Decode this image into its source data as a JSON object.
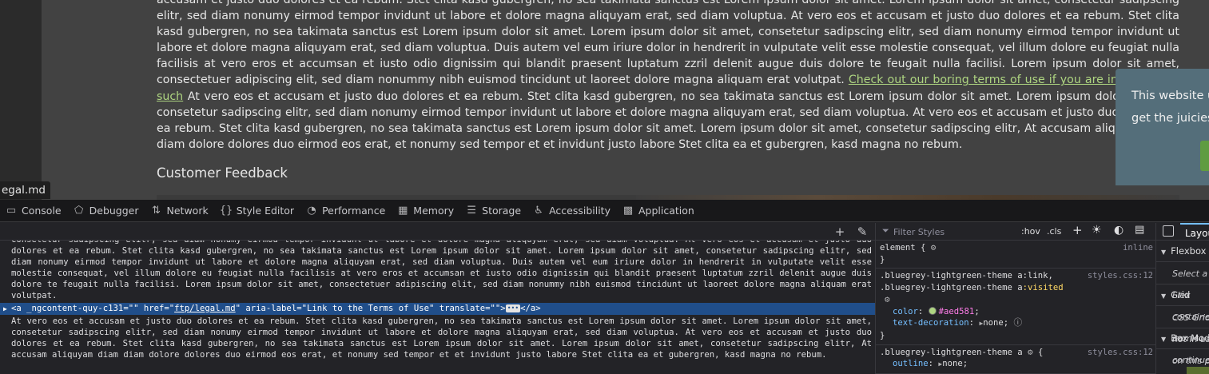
{
  "page": {
    "tab_label": "egal.md",
    "paragraph_before_link": "accusam et justo duo dolores et ea rebum. Stet clita kasd gubergren, no sea takimata sanctus est Lorem ipsum dolor sit amet. Lorem ipsum dolor sit amet, consetetur sadipscing elitr, sed diam nonumy eirmod tempor invidunt ut labore et dolore magna aliquyam erat, sed diam voluptua. At vero eos et accusam et justo duo dolores et ea rebum. Stet clita kasd gubergren, no sea takimata sanctus est Lorem ipsum dolor sit amet. Lorem ipsum dolor sit amet, consetetur sadipscing elitr, sed diam nonumy eirmod tempor invidunt ut labore et dolore magna aliquyam erat, sed diam voluptua. Duis autem vel eum iriure dolor in hendrerit in vulputate velit esse molestie consequat, vel illum dolore eu feugiat nulla facilisis at vero eros et accumsan et iusto odio dignissim qui blandit praesent luptatum zzril delenit augue duis dolore te feugait nulla facilisi. Lorem ipsum dolor sit amet, consectetuer adipiscing elit, sed diam nonummy nibh euismod tincidunt ut laoreet dolore magna aliquam erat volutpat.",
    "link_text": "Check out our boring terms of use if you are interested in such",
    "paragraph_after_link": "At vero eos et accusam et justo duo dolores et ea rebum. Stet clita kasd gubergren, no sea takimata sanctus est Lorem ipsum dolor sit amet. Lorem ipsum dolor sit amet, consetetur sadipscing elitr, sed diam nonumy eirmod tempor invidunt ut labore et dolore magna aliquyam erat, sed diam voluptua. At vero eos et accusam et justo duo dolores et ea rebum. Stet clita kasd gubergren, no sea takimata sanctus est Lorem ipsum dolor sit amet. Lorem ipsum dolor sit amet, consetetur sadipscing elitr, At accusam aliquyam diam diam dolore dolores duo eirmod eos erat, et nonumy sed tempor et et invidunt justo labore Stet clita ea et gubergren, kasd magna no rebum.",
    "feedback_heading": "Customer Feedback",
    "cookie_text": "This website uses cookies to ensure you get the juiciest tracking experience."
  },
  "devtools": {
    "tabs": [
      {
        "icon": "console-icon",
        "glyph": "▭",
        "label": "Console"
      },
      {
        "icon": "debugger-icon",
        "glyph": "⬠",
        "label": "Debugger"
      },
      {
        "icon": "network-icon",
        "glyph": "⇅",
        "label": "Network"
      },
      {
        "icon": "style-editor-icon",
        "glyph": "{}",
        "label": "Style Editor"
      },
      {
        "icon": "performance-icon",
        "glyph": "◔",
        "label": "Performance"
      },
      {
        "icon": "memory-icon",
        "glyph": "▦",
        "label": "Memory"
      },
      {
        "icon": "storage-icon",
        "glyph": "☰",
        "label": "Storage"
      },
      {
        "icon": "accessibility-icon",
        "glyph": "♿",
        "label": "Accessibility"
      },
      {
        "icon": "application-icon",
        "glyph": "▩",
        "label": "Application"
      }
    ],
    "markup": {
      "text_top": "consetetur sadipscing elitr, sed diam nonumy eirmod tempor invidunt ut labore et dolore magna aliquyam erat, sed diam voluptua. At vero eos et accusam et justo duo dolores et ea rebum. Stet clita kasd gubergren, no sea takimata sanctus est Lorem ipsum dolor sit amet. Lorem ipsum dolor sit amet, consetetur sadipscing elitr, sed diam nonumy eirmod tempor invidunt ut labore et dolore magna aliquyam erat, sed diam voluptua. Duis autem vel eum iriure dolor in hendrerit in vulputate velit esse molestie consequat, vel illum dolore eu feugiat nulla facilisis at vero eros et accumsan et iusto odio dignissim qui blandit praesent luptatum zzril delenit augue duis dolore te feugait nulla facilisi. Lorem ipsum dolor sit amet, consectetuer adipiscing elit, sed diam nonummy nibh euismod tincidunt ut laoreet dolore magna aliquam erat volutpat.",
      "selected_open": "<a _ngcontent-quy-c131=\"\" href=\"",
      "selected_href": "ftp/legal.md",
      "selected_rest": "\" aria-label=\"Link to the Terms of Use\" translate=\"\">",
      "selected_close": "</a>",
      "text_bottom": "At vero eos et accusam et justo duo dolores et ea rebum. Stet clita kasd gubergren, no sea takimata sanctus est Lorem ipsum dolor sit amet. Lorem ipsum dolor sit amet, consetetur sadipscing elitr, sed diam nonumy eirmod tempor invidunt ut labore et dolore magna aliquyam erat, sed diam voluptua. At vero eos et accusam et justo duo dolores et ea rebum. Stet clita kasd gubergren, no sea takimata sanctus est Lorem ipsum dolor sit amet. Lorem ipsum dolor sit amet, consetetur sadipscing elitr, At accusam aliquyam diam diam dolore dolores duo eirmod eos erat, et nonumy sed tempor et et invidunt justo labore Stet clita ea et gubergren, kasd magna no rebum."
    },
    "rules": {
      "filter_placeholder": "Filter Styles",
      "hov": ":hov",
      "cls": ".cls",
      "element_selector": "element {",
      "element_source": "inline",
      "close_brace": "}",
      "rule1_selector_a": ".bluegrey-lightgreen-theme a:link,",
      "rule1_selector_b_prefix": ".bluegrey-lightgreen-theme a",
      "rule1_selector_b_pseudo": ":visited",
      "rule1_source": "styles.css:12",
      "rule1_prop1": "color",
      "rule1_val1": "#aed581",
      "rule1_prop2": "text-decoration",
      "rule1_val2": "none",
      "rule2_selector": ".bluegrey-lightgreen-theme a",
      "rule2_source": "styles.css:12",
      "rule2_prop1": "outline",
      "rule2_val1": "none"
    },
    "layout": {
      "tab_label": "Layout",
      "flexbox": "Flexbox",
      "flexbox_sub": "Select a Flex container or item to continue.",
      "grid": "Grid",
      "grid_sub": "CSS Grid is not in use on this page",
      "box_model": "Box Model"
    }
  },
  "colors": {
    "link": "#aed581",
    "selection": "#204e8a",
    "cookie_bg": "#546e7a",
    "accept_button": "#5f9c41"
  }
}
